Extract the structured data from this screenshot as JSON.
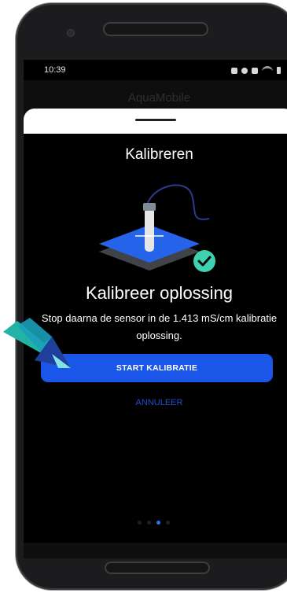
{
  "statusbar": {
    "time": "10:39",
    "icons": [
      "home-icon",
      "alarm-icon",
      "bluetooth-icon",
      "wifi-icon",
      "signal-icon",
      "battery-icon"
    ]
  },
  "app": {
    "title": "AquaMobile"
  },
  "sheet": {
    "title": "Kalibreren",
    "heading": "Kalibreer oplossing",
    "description": "Stop daarna de sensor in de 1.413 mS/cm kalibratie oplossing.",
    "primary_button": "START KALIBRATIE",
    "cancel_link": "ANNULEER",
    "illustration_icon": "sensor-calibration-icon",
    "check_icon": "check-circle-icon",
    "pager": {
      "count": 4,
      "active_index": 2
    }
  },
  "colors": {
    "accent": "#1a57e8",
    "check": "#3fd2b0",
    "sensor_plate": "#2563eb",
    "background": "#000000"
  }
}
